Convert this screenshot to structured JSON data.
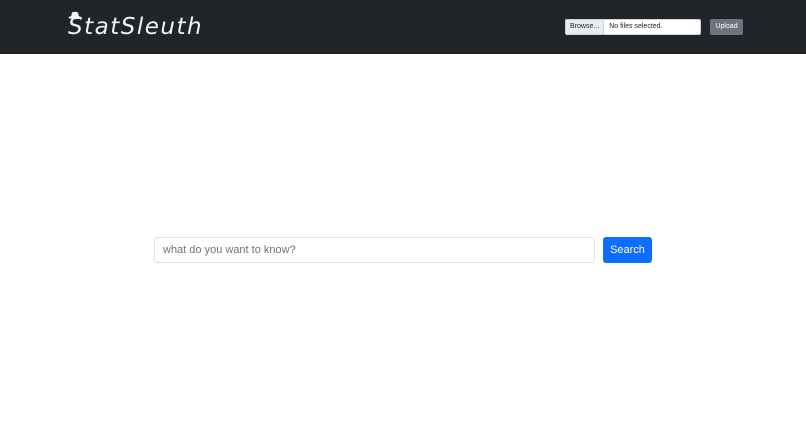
{
  "navbar": {
    "brand": "StatSleuth",
    "brand_icon": "detective-hat-icon",
    "file_input": {
      "button_label": "Browse...",
      "status": "No files selected."
    },
    "upload_label": "Upload"
  },
  "search": {
    "placeholder": "what do you want to know?",
    "value": "",
    "button_label": "Search"
  },
  "colors": {
    "navbar_bg": "#212529",
    "primary": "#0d6efd",
    "secondary": "#6c757d"
  }
}
